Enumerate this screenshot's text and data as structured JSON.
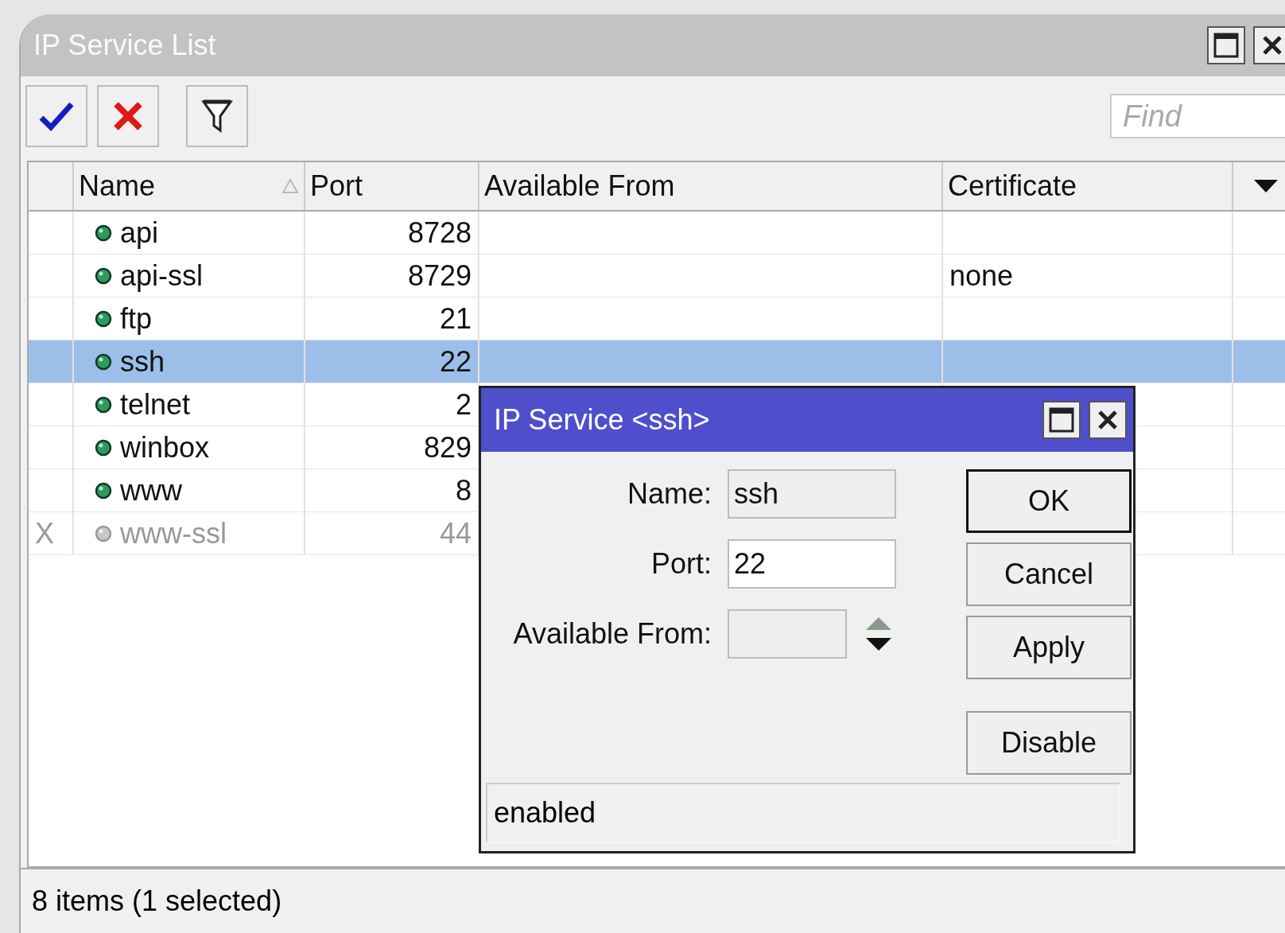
{
  "window": {
    "title": "IP Service List"
  },
  "toolbar": {
    "find": {
      "placeholder": "Find"
    }
  },
  "table": {
    "columns": [
      {
        "label": "Name",
        "sorted": true
      },
      {
        "label": "Port",
        "sorted": false
      },
      {
        "label": "Available From",
        "sorted": false
      },
      {
        "label": "Certificate",
        "sorted": false
      }
    ],
    "rows": [
      {
        "name": "api",
        "port": "8728",
        "disabled": false,
        "selected": false
      },
      {
        "name": "api-ssl",
        "port": "8729",
        "certificate": "none",
        "disabled": false,
        "selected": false
      },
      {
        "name": "ftp",
        "port": "21",
        "disabled": false,
        "selected": false
      },
      {
        "name": "ssh",
        "port": "22",
        "disabled": false,
        "selected": true
      },
      {
        "name": "telnet",
        "port": "2",
        "disabled": false,
        "selected": false
      },
      {
        "name": "winbox",
        "port": "829",
        "disabled": false,
        "selected": false
      },
      {
        "name": "www",
        "port": "8",
        "disabled": false,
        "selected": false
      },
      {
        "flag": "X",
        "name": "www-ssl",
        "port": "44",
        "disabled": true,
        "selected": false
      }
    ]
  },
  "status_bar": "8 items (1 selected)",
  "dialog": {
    "title": "IP Service <ssh>",
    "fields": [
      {
        "label": "Name:",
        "value": "ssh",
        "kind": "text",
        "disabled": true
      },
      {
        "label": "Port:",
        "value": "22",
        "kind": "text",
        "disabled": false
      },
      {
        "label": "Available From:",
        "kind": "spin",
        "disabled": true
      }
    ],
    "buttons": [
      {
        "label": "OK",
        "default": true
      },
      {
        "label": "Cancel",
        "default": false
      },
      {
        "label": "Apply",
        "default": false
      },
      {
        "label": "Disable",
        "default": false
      }
    ],
    "status": "enabled"
  }
}
